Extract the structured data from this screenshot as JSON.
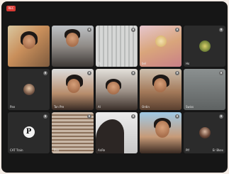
{
  "recording_badge": "REC",
  "participants": [
    {
      "name": "",
      "video": true
    },
    {
      "name": "",
      "video": true
    },
    {
      "name": "Ta",
      "video": true
    },
    {
      "name": "bel",
      "video": true
    },
    {
      "name": "Ho",
      "video": false
    },
    {
      "name": "Pan",
      "video": false
    },
    {
      "name": "Ton Pre",
      "video": true
    },
    {
      "name": "Al",
      "video": true
    },
    {
      "name": "Ordin",
      "video": true
    },
    {
      "name": "Swiss",
      "video": true
    },
    {
      "name": "CAT Train",
      "video": false
    },
    {
      "name": "Pan",
      "video": true
    },
    {
      "name": "AnRe",
      "video": true
    },
    {
      "name": "",
      "video": true
    },
    {
      "name": "Plf",
      "second": "Er Bkex",
      "video": false
    }
  ]
}
